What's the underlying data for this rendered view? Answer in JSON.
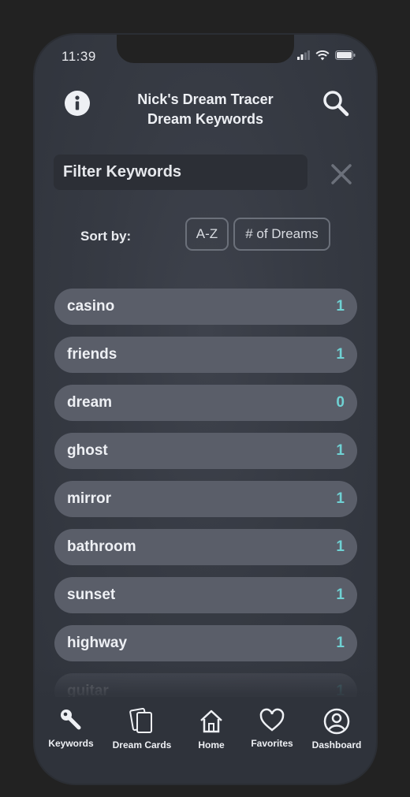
{
  "status_bar": {
    "time": "11:39"
  },
  "header": {
    "title_line1": "Nick's Dream Tracer",
    "title_line2": "Dream Keywords"
  },
  "filter": {
    "placeholder": "Filter Keywords"
  },
  "sort": {
    "label": "Sort by:",
    "options": [
      "A-Z",
      "# of Dreams"
    ]
  },
  "keywords": [
    {
      "word": "casino",
      "count": "1"
    },
    {
      "word": "friends",
      "count": "1"
    },
    {
      "word": "dream",
      "count": "0"
    },
    {
      "word": "ghost",
      "count": "1"
    },
    {
      "word": "mirror",
      "count": "1"
    },
    {
      "word": "bathroom",
      "count": "1"
    },
    {
      "word": "sunset",
      "count": "1"
    },
    {
      "word": "highway",
      "count": "1"
    },
    {
      "word": "guitar",
      "count": "1"
    }
  ],
  "tabs": [
    {
      "label": "Keywords",
      "icon": "key-icon"
    },
    {
      "label": "Dream Cards",
      "icon": "cards-icon"
    },
    {
      "label": "Home",
      "icon": "home-icon"
    },
    {
      "label": "Favorites",
      "icon": "heart-icon"
    },
    {
      "label": "Dashboard",
      "icon": "user-icon"
    }
  ],
  "colors": {
    "count_accent": "#6fd1d3",
    "pill": "#5a5e69",
    "background": "#363a43"
  }
}
